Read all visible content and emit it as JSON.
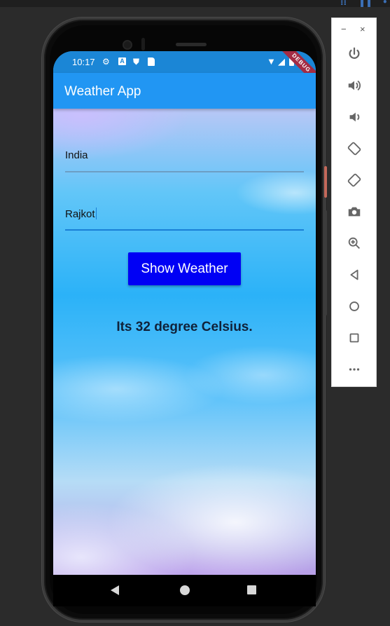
{
  "status": {
    "time": "10:17",
    "debug_label": "DEBUG"
  },
  "app": {
    "title": "Weather App"
  },
  "form": {
    "country_value": "India",
    "city_value": "Rajkot",
    "button_label": "Show Weather"
  },
  "result": {
    "text": "Its 32 degree Celsius."
  },
  "emulator": {
    "minimize": "−",
    "close": "×",
    "tools": [
      "power-icon",
      "volume-up-icon",
      "volume-down-icon",
      "rotate-left-icon",
      "rotate-right-icon",
      "camera-icon",
      "zoom-icon",
      "back-icon",
      "home-icon",
      "overview-icon",
      "more-icon"
    ]
  },
  "colors": {
    "appbar": "#2196f3",
    "button": "#0000f5",
    "statusbar": "#1b86d6"
  }
}
